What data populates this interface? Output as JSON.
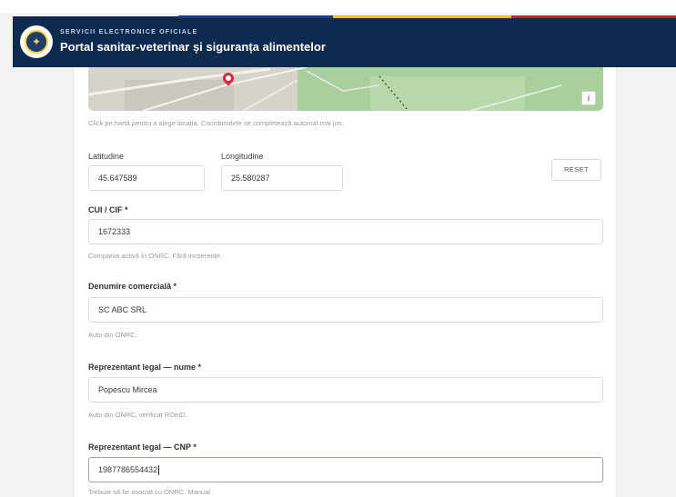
{
  "header": {
    "kicker": "SERVICII ELECTRONICE OFICIALE",
    "title": "Portal sanitar-veterinar și siguranța alimentelor",
    "colors": {
      "navy": "#0e2a4f",
      "blue": "#1d3e8f",
      "yellow": "#f4c20d",
      "red": "#c1272d"
    }
  },
  "map": {
    "hint": "Click pe hartă pentru a alege locația. Coordonatele se completează automat mai jos.",
    "control_label": "i"
  },
  "coordinates": {
    "latitude_label": "Latitudine",
    "latitude_value": "45.647589",
    "longitude_label": "Longitudine",
    "longitude_value": "25.580287",
    "reset_label": "RESET"
  },
  "form": {
    "cui": {
      "label": "CUI / CIF *",
      "value": "1672333",
      "hint": "Compania activă în ONRC. Fără incoerențe."
    },
    "company": {
      "label": "Denumire comercială *",
      "value": "SC ABC SRL",
      "hint": "Auto din ONRC."
    },
    "rep_name": {
      "label": "Reprezentant legal — nume *",
      "value": "Popescu Mircea",
      "hint": "Auto din ONRC, verificat ROeID."
    },
    "rep_cnp": {
      "label": "Reprezentant legal — CNP *",
      "value": "1987786554432",
      "hint": "Trebuie să fie asociat cu ONRC. Manual."
    }
  }
}
